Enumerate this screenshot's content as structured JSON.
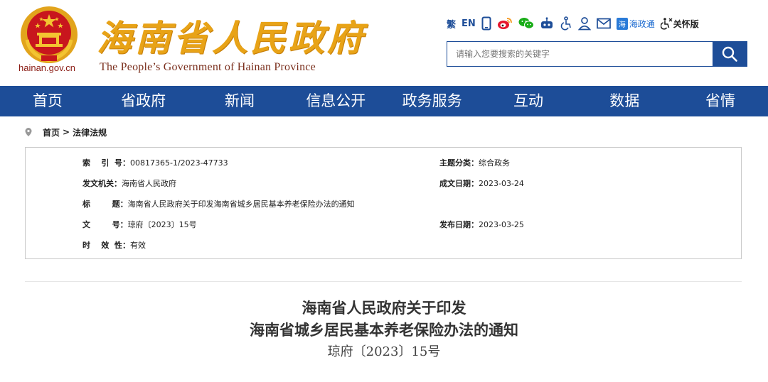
{
  "header": {
    "site_domain": "hainan.gov.cn",
    "title": "海南省人民政府",
    "subtitle": "The People’s Government  of Hainan Province"
  },
  "toolbar": {
    "traditional": "繁",
    "english": "EN",
    "haizhengtong_badge": "海",
    "haizhengtong": "海政通",
    "care_mode": "关怀版"
  },
  "search": {
    "placeholder": "请输入您要搜索的关键字"
  },
  "nav": {
    "items": [
      "首页",
      "省政府",
      "新闻",
      "信息公开",
      "政务服务",
      "互动",
      "数据",
      "省情"
    ]
  },
  "breadcrumb": {
    "home": "首页",
    "separator": ">",
    "current": "法律法规"
  },
  "info": {
    "index_label": "索    引  号：",
    "index_value": "00817365-1/2023-47733",
    "category_label": "主题分类：",
    "category_value": "综合政务",
    "issuer_label": "发文机关：",
    "issuer_value": "海南省人民政府",
    "date_label": "成文日期：",
    "date_value": "2023-03-24",
    "title_label": "标        题：",
    "title_value": "海南省人民政府关于印发海南省城乡居民基本养老保险办法的通知",
    "doc_no_label": "文        号：",
    "doc_no_value": "琼府〔2023〕15号",
    "publish_label": "发布日期：",
    "publish_value": "2023-03-25",
    "validity_label": "时    效  性：",
    "validity_value": "有效"
  },
  "document": {
    "title_line1": "海南省人民政府关于印发",
    "title_line2": "海南省城乡居民基本养老保险办法的通知",
    "number": "琼府〔2023〕15号"
  },
  "colors": {
    "brand_blue": "#1d4d98",
    "title_gold": "#e8a317",
    "emblem_red": "#c8161d"
  }
}
